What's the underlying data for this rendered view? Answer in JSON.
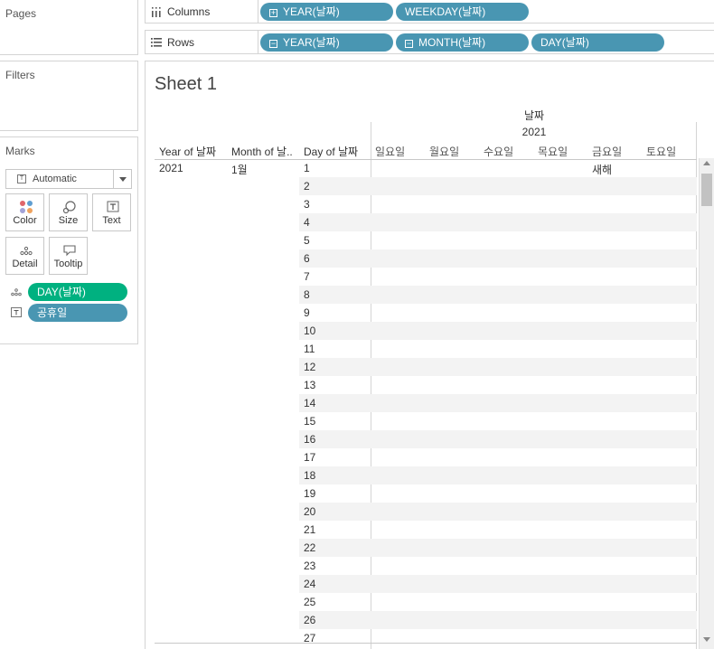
{
  "left_panel": {
    "pages_title": "Pages",
    "filters_title": "Filters",
    "marks_title": "Marks",
    "mark_type": "Automatic",
    "buttons": {
      "color": "Color",
      "size": "Size",
      "text": "Text",
      "detail": "Detail",
      "tooltip": "Tooltip"
    },
    "mark_pills": [
      {
        "label": "DAY(날짜)",
        "role": "detail"
      },
      {
        "label": "공휴일",
        "role": "text"
      }
    ]
  },
  "columns_shelf": {
    "label": "Columns",
    "pills": [
      "YEAR(날짜)",
      "WEEKDAY(날짜)"
    ]
  },
  "rows_shelf": {
    "label": "Rows",
    "pills": [
      "YEAR(날짜)",
      "MONTH(날짜)",
      "DAY(날짜)"
    ]
  },
  "sheet": {
    "title": "Sheet 1",
    "column_header_field": "날짜",
    "column_year": "2021",
    "row_headers": [
      "Year of 날짜",
      "Month of 날..",
      "Day of 날짜"
    ],
    "weekdays": [
      "일요일",
      "월요일",
      "수요일",
      "목요일",
      "금요일",
      "토요일"
    ],
    "year_value": "2021",
    "month_value": "1월",
    "days": [
      "1",
      "2",
      "3",
      "4",
      "5",
      "6",
      "7",
      "8",
      "9",
      "10",
      "11",
      "12",
      "13",
      "14",
      "15",
      "16",
      "17",
      "18",
      "19",
      "20",
      "21",
      "22",
      "23",
      "24",
      "25",
      "26",
      "27"
    ],
    "holiday_label": "새해"
  },
  "colors": {
    "pill_blue": "#4996b2",
    "pill_green": "#00b180",
    "row_alt": "#f3f3f3",
    "border": "#d4d4d4"
  }
}
